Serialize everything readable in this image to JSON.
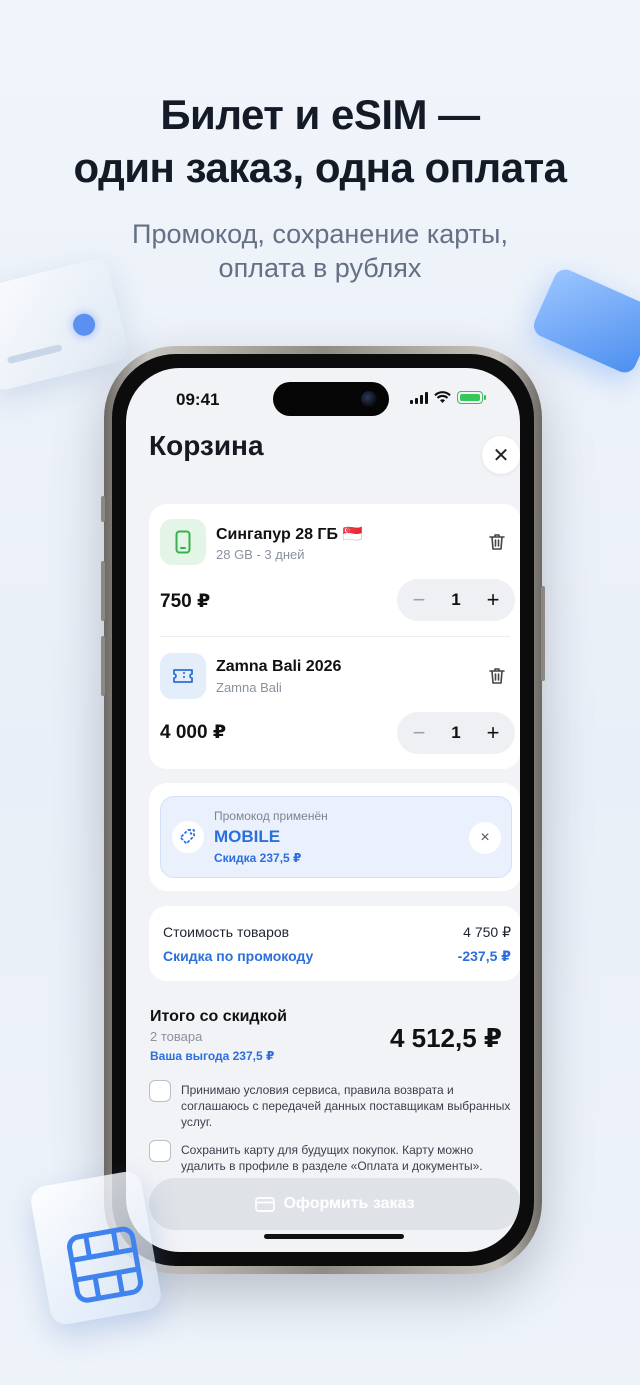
{
  "promo_header": {
    "headline_line1": "Билет и eSIM —",
    "headline_line2": "один заказ, одна оплата",
    "subtitle_line1": "Промокод, сохранение карты,",
    "subtitle_line2": "оплата в рублях"
  },
  "status_bar": {
    "time": "09:41"
  },
  "cart": {
    "title": "Корзина",
    "close_icon": "close-icon",
    "items": [
      {
        "name": "Сингапур 28 ГБ 🇸🇬",
        "meta": "28 GB - 3 дней",
        "price": "750 ₽",
        "quantity": "1",
        "icon": "phone-icon",
        "icon_bg": "#e3f5e6",
        "icon_color": "#36b24a"
      },
      {
        "name": "Zamna Bali 2026",
        "meta": "Zamna Bali",
        "price": "4 000 ₽",
        "quantity": "1",
        "icon": "ticket-icon",
        "icon_bg": "#e4eefb",
        "icon_color": "#2c6fdb"
      }
    ],
    "stepper": {
      "minus": "−",
      "plus": "+"
    },
    "promo": {
      "label": "Промокод применён",
      "code": "MOBILE",
      "discount": "Скидка 237,5 ₽",
      "remove_icon": "×"
    },
    "summary": {
      "goods_label": "Стоимость товаров",
      "goods_value": "4 750 ₽",
      "discount_label": "Скидка по промокоду",
      "discount_value": "-237,5 ₽"
    },
    "total": {
      "title": "Итого со скидкой",
      "count": "2 товара",
      "savings": "Ваша выгода 237,5 ₽",
      "sum": "4 512,5 ₽"
    },
    "consents": [
      {
        "text": "Принимаю условия сервиса, правила возврата и соглашаюсь с передачей данных поставщикам выбранных услуг.",
        "checked": false
      },
      {
        "text": "Сохранить карту для будущих покупок. Карту можно удалить в профиле в разделе «Оплата и документы».",
        "checked": false
      }
    ],
    "order_button": "Оформить заказ"
  },
  "colors": {
    "accent": "#2c6fdb",
    "success": "#34c759",
    "disabled_button": "#dfe2e7"
  }
}
